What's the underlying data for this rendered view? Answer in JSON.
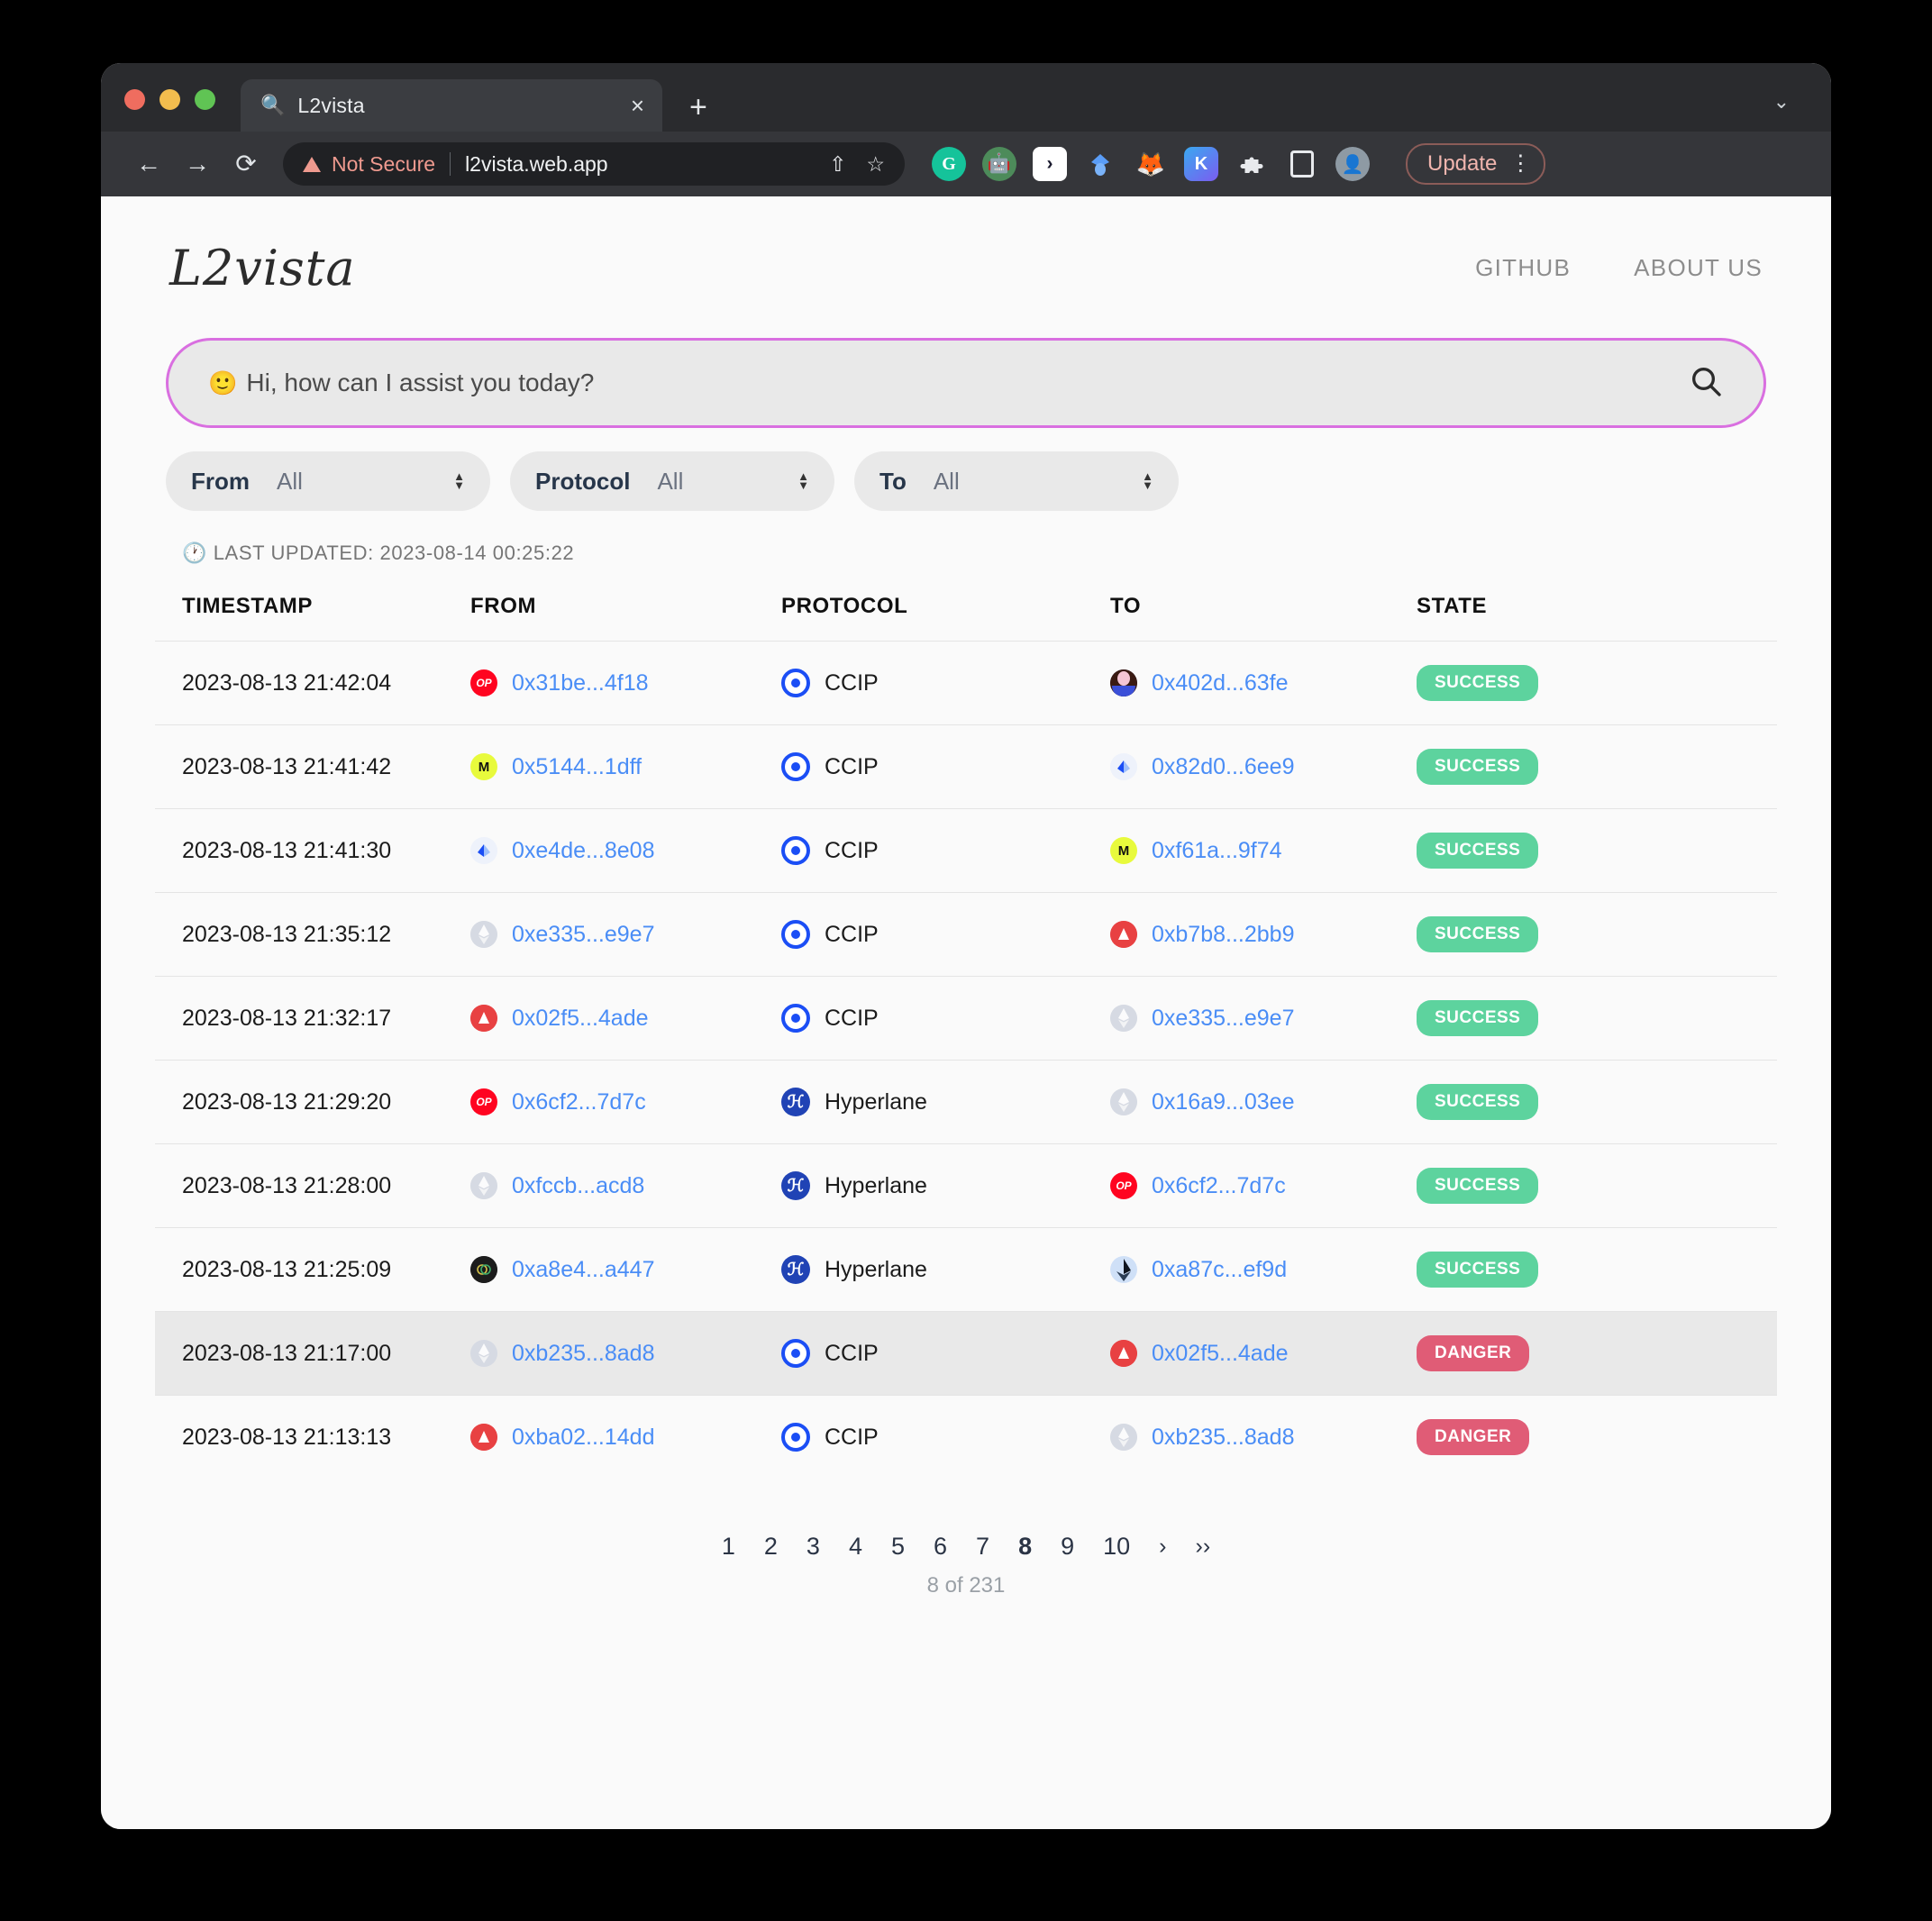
{
  "browser": {
    "tab": {
      "title": "L2vista",
      "favicon": "search-icon",
      "close": "×"
    },
    "new_tab": "+",
    "tabbar_caret": "⌄",
    "nav": {
      "back": "←",
      "forward": "→",
      "reload": "⟳"
    },
    "omnibox": {
      "security_label": "Not Secure",
      "url": "l2vista.web.app",
      "share_icon": "⇧",
      "bookmark_icon": "☆"
    },
    "extensions": [
      {
        "name": "grammarly-extension",
        "glyph": "G"
      },
      {
        "name": "robot-extension",
        "glyph": "🤖"
      },
      {
        "name": "pocket-universe-extension",
        "glyph": "›"
      },
      {
        "name": "rabby-wallet-extension",
        "glyph": "◆"
      },
      {
        "name": "metamask-extension",
        "glyph": "🦊"
      },
      {
        "name": "keplr-wallet-extension",
        "glyph": "K"
      },
      {
        "name": "extensions-puzzle",
        "glyph": "🧩"
      },
      {
        "name": "side-panel",
        "glyph": ""
      },
      {
        "name": "profile-avatar",
        "glyph": "👤"
      }
    ],
    "update_button": "Update",
    "kebab": "⋮"
  },
  "site": {
    "logo": "L2vista",
    "nav": [
      {
        "label": "GITHUB",
        "name": "nav-link-github"
      },
      {
        "label": "ABOUT US",
        "name": "nav-link-about-us"
      }
    ]
  },
  "search": {
    "emoji": "🙂",
    "placeholder": "Hi, how can I assist you today?",
    "value": "",
    "icon": "search-icon"
  },
  "filters": [
    {
      "label": "From",
      "value": "All",
      "name": "filter-from"
    },
    {
      "label": "Protocol",
      "value": "All",
      "name": "filter-protocol"
    },
    {
      "label": "To",
      "value": "All",
      "name": "filter-to"
    }
  ],
  "last_updated": "🕐 LAST UPDATED: 2023-08-14 00:25:22",
  "table": {
    "columns": [
      "TIMESTAMP",
      "FROM",
      "PROTOCOL",
      "TO",
      "STATE"
    ],
    "rows": [
      {
        "timestamp": "2023-08-13 21:42:04",
        "from": {
          "address": "0x31be...4f18",
          "chain": "optimism",
          "chain_glyph": "OP"
        },
        "protocol": {
          "name": "CCIP",
          "icon": "ccip"
        },
        "to": {
          "address": "0x402d...63fe",
          "chain": "polygon",
          "chain_glyph": ""
        },
        "state": "SUCCESS",
        "highlight": false
      },
      {
        "timestamp": "2023-08-13 21:41:42",
        "from": {
          "address": "0x5144...1dff",
          "chain": "moonbeam",
          "chain_glyph": "M"
        },
        "protocol": {
          "name": "CCIP",
          "icon": "ccip"
        },
        "to": {
          "address": "0x82d0...6ee9",
          "chain": "arbitrum",
          "chain_glyph": ""
        },
        "state": "SUCCESS",
        "highlight": false
      },
      {
        "timestamp": "2023-08-13 21:41:30",
        "from": {
          "address": "0xe4de...8e08",
          "chain": "arbitrum",
          "chain_glyph": ""
        },
        "protocol": {
          "name": "CCIP",
          "icon": "ccip"
        },
        "to": {
          "address": "0xf61a...9f74",
          "chain": "moonbeam",
          "chain_glyph": "M"
        },
        "state": "SUCCESS",
        "highlight": false
      },
      {
        "timestamp": "2023-08-13 21:35:12",
        "from": {
          "address": "0xe335...e9e7",
          "chain": "ethereum",
          "chain_glyph": ""
        },
        "protocol": {
          "name": "CCIP",
          "icon": "ccip"
        },
        "to": {
          "address": "0xb7b8...2bb9",
          "chain": "avalanche",
          "chain_glyph": ""
        },
        "state": "SUCCESS",
        "highlight": false
      },
      {
        "timestamp": "2023-08-13 21:32:17",
        "from": {
          "address": "0x02f5...4ade",
          "chain": "avalanche",
          "chain_glyph": ""
        },
        "protocol": {
          "name": "CCIP",
          "icon": "ccip"
        },
        "to": {
          "address": "0xe335...e9e7",
          "chain": "ethereum",
          "chain_glyph": ""
        },
        "state": "SUCCESS",
        "highlight": false
      },
      {
        "timestamp": "2023-08-13 21:29:20",
        "from": {
          "address": "0x6cf2...7d7c",
          "chain": "optimism",
          "chain_glyph": "OP"
        },
        "protocol": {
          "name": "Hyperlane",
          "icon": "hyperlane"
        },
        "to": {
          "address": "0x16a9...03ee",
          "chain": "ethereum",
          "chain_glyph": ""
        },
        "state": "SUCCESS",
        "highlight": false
      },
      {
        "timestamp": "2023-08-13 21:28:00",
        "from": {
          "address": "0xfccb...acd8",
          "chain": "ethereum",
          "chain_glyph": ""
        },
        "protocol": {
          "name": "Hyperlane",
          "icon": "hyperlane"
        },
        "to": {
          "address": "0x6cf2...7d7c",
          "chain": "optimism",
          "chain_glyph": "OP"
        },
        "state": "SUCCESS",
        "highlight": false
      },
      {
        "timestamp": "2023-08-13 21:25:09",
        "from": {
          "address": "0xa8e4...a447",
          "chain": "dark",
          "chain_glyph": ""
        },
        "protocol": {
          "name": "Hyperlane",
          "icon": "hyperlane"
        },
        "to": {
          "address": "0xa87c...ef9d",
          "chain": "zksync",
          "chain_glyph": ""
        },
        "state": "SUCCESS",
        "highlight": false
      },
      {
        "timestamp": "2023-08-13 21:17:00",
        "from": {
          "address": "0xb235...8ad8",
          "chain": "ethereum",
          "chain_glyph": ""
        },
        "protocol": {
          "name": "CCIP",
          "icon": "ccip"
        },
        "to": {
          "address": "0x02f5...4ade",
          "chain": "avalanche",
          "chain_glyph": ""
        },
        "state": "DANGER",
        "highlight": true
      },
      {
        "timestamp": "2023-08-13 21:13:13",
        "from": {
          "address": "0xba02...14dd",
          "chain": "avalanche",
          "chain_glyph": ""
        },
        "protocol": {
          "name": "CCIP",
          "icon": "ccip"
        },
        "to": {
          "address": "0xb235...8ad8",
          "chain": "ethereum",
          "chain_glyph": ""
        },
        "state": "DANGER",
        "highlight": false
      }
    ]
  },
  "pagination": {
    "pages": [
      "1",
      "2",
      "3",
      "4",
      "5",
      "6",
      "7",
      "8",
      "9",
      "10"
    ],
    "active": "8",
    "next": "›",
    "last": "››",
    "count_label": "8 of 231"
  }
}
